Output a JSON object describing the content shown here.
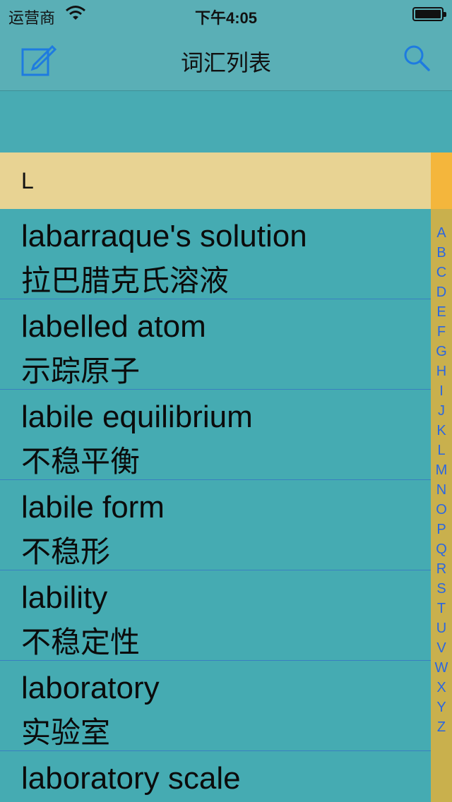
{
  "status_bar": {
    "carrier": "运营商",
    "time": "下午4:05"
  },
  "nav": {
    "title": "词汇列表"
  },
  "section": {
    "letter": "L"
  },
  "entries": [
    {
      "term": "labarraque's solution",
      "translation": "拉巴腊克氏溶液"
    },
    {
      "term": "labelled atom",
      "translation": "示踪原子"
    },
    {
      "term": "labile equilibrium",
      "translation": "不稳平衡"
    },
    {
      "term": "labile form",
      "translation": "不稳形"
    },
    {
      "term": "lability",
      "translation": "不稳定性"
    },
    {
      "term": "laboratory",
      "translation": "实验室"
    },
    {
      "term": "laboratory scale",
      "translation": ""
    }
  ],
  "index_letters": [
    "A",
    "B",
    "C",
    "D",
    "E",
    "F",
    "G",
    "H",
    "I",
    "J",
    "K",
    "L",
    "M",
    "N",
    "O",
    "P",
    "Q",
    "R",
    "S",
    "T",
    "U",
    "V",
    "W",
    "X",
    "Y",
    "Z"
  ],
  "colors": {
    "nav_background": "#5aafb6",
    "list_background": "#45abb2",
    "section_header": "#e8d393",
    "index_bar": "#c9b04d",
    "index_letter": "#2b66e0",
    "accent_blue": "#1e7be0"
  }
}
